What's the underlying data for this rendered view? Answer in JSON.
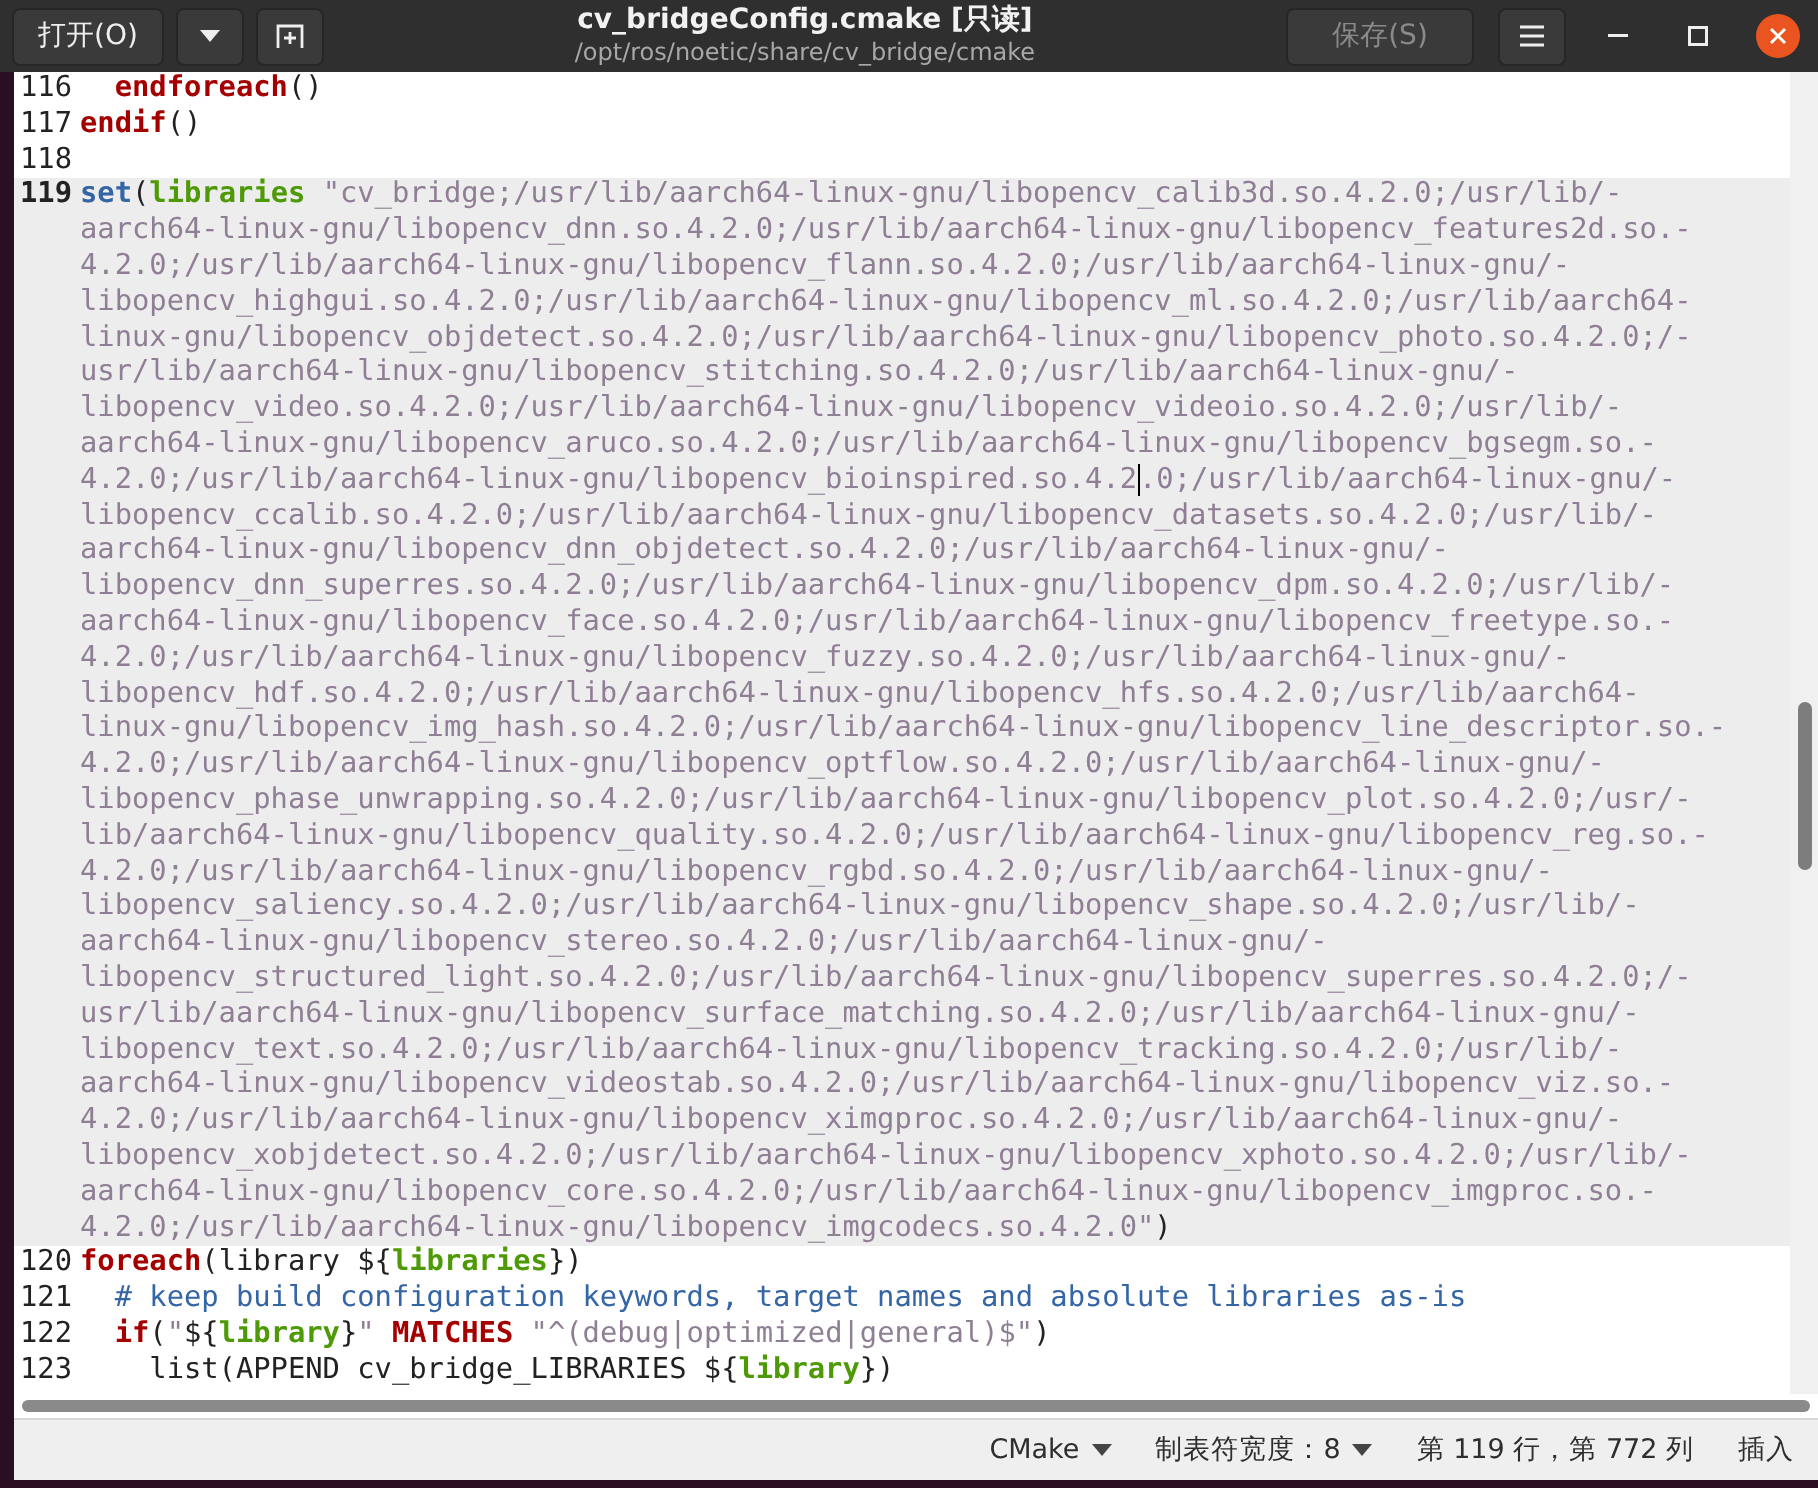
{
  "header": {
    "open_button": "打开(O)",
    "title": "cv_bridgeConfig.cmake [只读]",
    "subtitle": "/opt/ros/noetic/share/cv_bridge/cmake",
    "save_button": {
      "label": "保存(S)",
      "disabled": true
    }
  },
  "lines": [
    {
      "number": "116",
      "current": false,
      "rows": [
        {
          "tokens": [
            {
              "kind": "control",
              "text": "  endforeach"
            },
            {
              "kind": "plain",
              "text": "()"
            }
          ]
        }
      ]
    },
    {
      "number": "117",
      "current": false,
      "rows": [
        {
          "tokens": [
            {
              "kind": "control",
              "text": "endif"
            },
            {
              "kind": "plain",
              "text": "()"
            }
          ]
        }
      ]
    },
    {
      "number": "118",
      "current": false
    },
    {
      "number": "119",
      "current": true,
      "rows": [
        {
          "tokens": [
            {
              "kind": "command",
              "text": "set"
            },
            {
              "kind": "plain",
              "text": "("
            },
            {
              "kind": "variable",
              "text": "libraries"
            },
            {
              "kind": "string",
              "text": " \"cv_bridge;/usr/lib/aarch64-linux-gnu/libopencv_calib3d.so.4.2.0;/usr/lib/-"
            }
          ]
        },
        {
          "tokens": [
            {
              "kind": "string",
              "text": "aarch64-linux-gnu/libopencv_dnn.so.4.2.0;/usr/lib/aarch64-linux-gnu/libopencv_features2d.so.-"
            }
          ]
        },
        {
          "tokens": [
            {
              "kind": "string",
              "text": "4.2.0;/usr/lib/aarch64-linux-gnu/libopencv_flann.so.4.2.0;/usr/lib/aarch64-linux-gnu/-"
            }
          ]
        },
        {
          "tokens": [
            {
              "kind": "string",
              "text": "libopencv_highgui.so.4.2.0;/usr/lib/aarch64-linux-gnu/libopencv_ml.so.4.2.0;/usr/lib/aarch64-"
            }
          ]
        },
        {
          "tokens": [
            {
              "kind": "string",
              "text": "linux-gnu/libopencv_objdetect.so.4.2.0;/usr/lib/aarch64-linux-gnu/libopencv_photo.so.4.2.0;/-"
            }
          ]
        },
        {
          "tokens": [
            {
              "kind": "string",
              "text": "usr/lib/aarch64-linux-gnu/libopencv_stitching.so.4.2.0;/usr/lib/aarch64-linux-gnu/-"
            }
          ]
        },
        {
          "tokens": [
            {
              "kind": "string",
              "text": "libopencv_video.so.4.2.0;/usr/lib/aarch64-linux-gnu/libopencv_videoio.so.4.2.0;/usr/lib/-"
            }
          ]
        },
        {
          "tokens": [
            {
              "kind": "string",
              "text": "aarch64-linux-gnu/libopencv_aruco.so.4.2.0;/usr/lib/aarch64-linux-gnu/libopencv_bgsegm.so.-"
            }
          ]
        },
        {
          "tokens": [
            {
              "kind": "string",
              "text": "4.2.0;/usr/lib/aarch64-linux-gnu/libopencv_bioinspired.so.4.2"
            },
            {
              "kind": "caret"
            },
            {
              "kind": "string",
              "text": ".0;/usr/lib/aarch64-linux-gnu/-"
            }
          ]
        },
        {
          "tokens": [
            {
              "kind": "string",
              "text": "libopencv_ccalib.so.4.2.0;/usr/lib/aarch64-linux-gnu/libopencv_datasets.so.4.2.0;/usr/lib/-"
            }
          ]
        },
        {
          "tokens": [
            {
              "kind": "string",
              "text": "aarch64-linux-gnu/libopencv_dnn_objdetect.so.4.2.0;/usr/lib/aarch64-linux-gnu/-"
            }
          ]
        },
        {
          "tokens": [
            {
              "kind": "string",
              "text": "libopencv_dnn_superres.so.4.2.0;/usr/lib/aarch64-linux-gnu/libopencv_dpm.so.4.2.0;/usr/lib/-"
            }
          ]
        },
        {
          "tokens": [
            {
              "kind": "string",
              "text": "aarch64-linux-gnu/libopencv_face.so.4.2.0;/usr/lib/aarch64-linux-gnu/libopencv_freetype.so.-"
            }
          ]
        },
        {
          "tokens": [
            {
              "kind": "string",
              "text": "4.2.0;/usr/lib/aarch64-linux-gnu/libopencv_fuzzy.so.4.2.0;/usr/lib/aarch64-linux-gnu/-"
            }
          ]
        },
        {
          "tokens": [
            {
              "kind": "string",
              "text": "libopencv_hdf.so.4.2.0;/usr/lib/aarch64-linux-gnu/libopencv_hfs.so.4.2.0;/usr/lib/aarch64-"
            }
          ]
        },
        {
          "tokens": [
            {
              "kind": "string",
              "text": "linux-gnu/libopencv_img_hash.so.4.2.0;/usr/lib/aarch64-linux-gnu/libopencv_line_descriptor.so.-"
            }
          ]
        },
        {
          "tokens": [
            {
              "kind": "string",
              "text": "4.2.0;/usr/lib/aarch64-linux-gnu/libopencv_optflow.so.4.2.0;/usr/lib/aarch64-linux-gnu/-"
            }
          ]
        },
        {
          "tokens": [
            {
              "kind": "string",
              "text": "libopencv_phase_unwrapping.so.4.2.0;/usr/lib/aarch64-linux-gnu/libopencv_plot.so.4.2.0;/usr/-"
            }
          ]
        },
        {
          "tokens": [
            {
              "kind": "string",
              "text": "lib/aarch64-linux-gnu/libopencv_quality.so.4.2.0;/usr/lib/aarch64-linux-gnu/libopencv_reg.so.-"
            }
          ]
        },
        {
          "tokens": [
            {
              "kind": "string",
              "text": "4.2.0;/usr/lib/aarch64-linux-gnu/libopencv_rgbd.so.4.2.0;/usr/lib/aarch64-linux-gnu/-"
            }
          ]
        },
        {
          "tokens": [
            {
              "kind": "string",
              "text": "libopencv_saliency.so.4.2.0;/usr/lib/aarch64-linux-gnu/libopencv_shape.so.4.2.0;/usr/lib/-"
            }
          ]
        },
        {
          "tokens": [
            {
              "kind": "string",
              "text": "aarch64-linux-gnu/libopencv_stereo.so.4.2.0;/usr/lib/aarch64-linux-gnu/-"
            }
          ]
        },
        {
          "tokens": [
            {
              "kind": "string",
              "text": "libopencv_structured_light.so.4.2.0;/usr/lib/aarch64-linux-gnu/libopencv_superres.so.4.2.0;/-"
            }
          ]
        },
        {
          "tokens": [
            {
              "kind": "string",
              "text": "usr/lib/aarch64-linux-gnu/libopencv_surface_matching.so.4.2.0;/usr/lib/aarch64-linux-gnu/-"
            }
          ]
        },
        {
          "tokens": [
            {
              "kind": "string",
              "text": "libopencv_text.so.4.2.0;/usr/lib/aarch64-linux-gnu/libopencv_tracking.so.4.2.0;/usr/lib/-"
            }
          ]
        },
        {
          "tokens": [
            {
              "kind": "string",
              "text": "aarch64-linux-gnu/libopencv_videostab.so.4.2.0;/usr/lib/aarch64-linux-gnu/libopencv_viz.so.-"
            }
          ]
        },
        {
          "tokens": [
            {
              "kind": "string",
              "text": "4.2.0;/usr/lib/aarch64-linux-gnu/libopencv_ximgproc.so.4.2.0;/usr/lib/aarch64-linux-gnu/-"
            }
          ]
        },
        {
          "tokens": [
            {
              "kind": "string",
              "text": "libopencv_xobjdetect.so.4.2.0;/usr/lib/aarch64-linux-gnu/libopencv_xphoto.so.4.2.0;/usr/lib/-"
            }
          ]
        },
        {
          "tokens": [
            {
              "kind": "string",
              "text": "aarch64-linux-gnu/libopencv_core.so.4.2.0;/usr/lib/aarch64-linux-gnu/libopencv_imgproc.so.-"
            }
          ]
        },
        {
          "tokens": [
            {
              "kind": "string",
              "text": "4.2.0;/usr/lib/aarch64-linux-gnu/libopencv_imgcodecs.so.4.2.0\""
            },
            {
              "kind": "plain",
              "text": ")"
            }
          ]
        }
      ]
    },
    {
      "number": "120",
      "current": false,
      "rows": [
        {
          "tokens": [
            {
              "kind": "control",
              "text": "foreach"
            },
            {
              "kind": "plain",
              "text": "(library ${"
            },
            {
              "kind": "variable",
              "text": "libraries"
            },
            {
              "kind": "plain",
              "text": "})"
            }
          ]
        }
      ]
    },
    {
      "number": "121",
      "current": false,
      "rows": [
        {
          "tokens": [
            {
              "kind": "comment",
              "text": "  # keep build configuration keywords, target names and absolute libraries as-is"
            }
          ]
        }
      ]
    },
    {
      "number": "122",
      "current": false,
      "rows": [
        {
          "tokens": [
            {
              "kind": "control",
              "text": "  if"
            },
            {
              "kind": "plain",
              "text": "("
            },
            {
              "kind": "string",
              "text": "\""
            },
            {
              "kind": "plain",
              "text": "${"
            },
            {
              "kind": "variable",
              "text": "library"
            },
            {
              "kind": "plain",
              "text": "}"
            },
            {
              "kind": "string",
              "text": "\" "
            },
            {
              "kind": "control",
              "text": "MATCHES"
            },
            {
              "kind": "string",
              "text": " \"^(debug|optimized|general)$\""
            },
            {
              "kind": "plain",
              "text": ")"
            }
          ]
        }
      ]
    },
    {
      "number": "123",
      "current": false,
      "rows": [
        {
          "tokens": [
            {
              "kind": "plain",
              "text": "    list(APPEND cv_bridge_LIBRARIES ${"
            },
            {
              "kind": "variable",
              "text": "library"
            },
            {
              "kind": "plain",
              "text": "})"
            }
          ]
        }
      ]
    }
  ],
  "status_bar": {
    "language": "CMake",
    "tab_width": "制表符宽度：8",
    "position": "第 119 行，第 772 列",
    "mode": "插入"
  }
}
